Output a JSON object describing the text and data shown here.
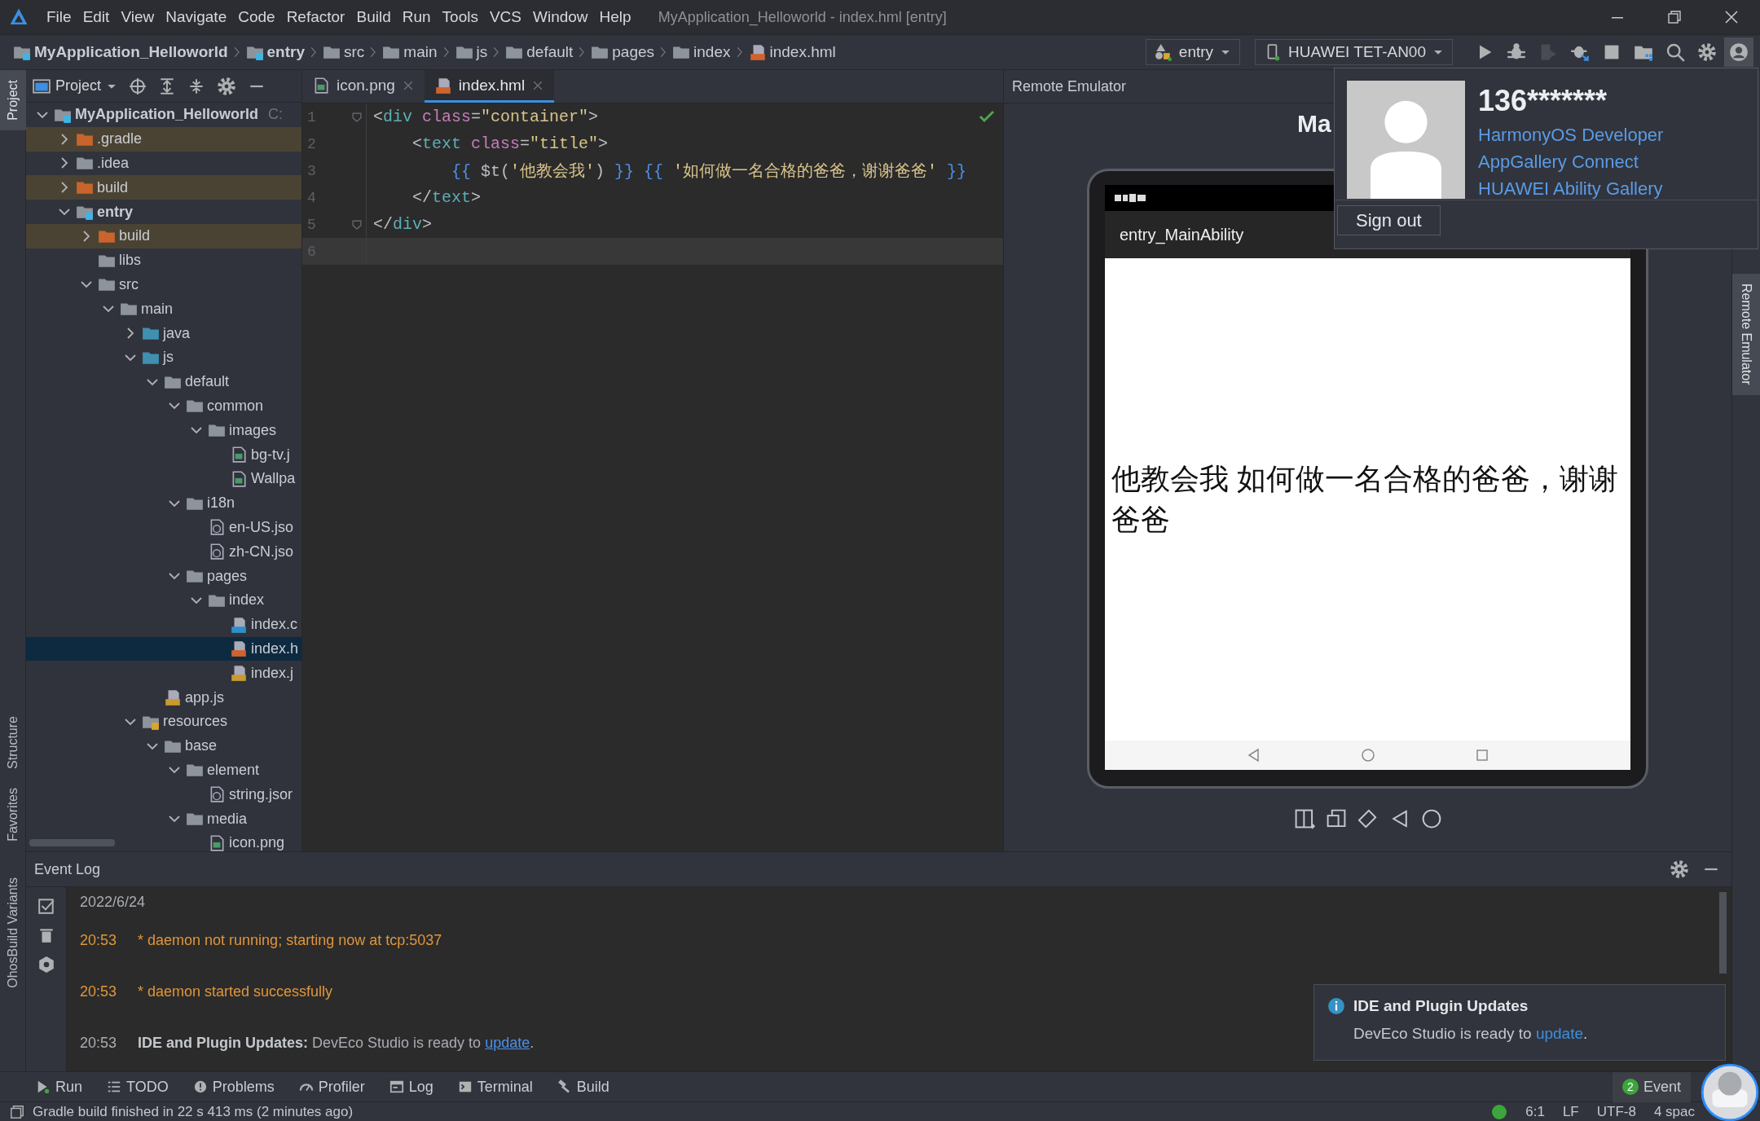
{
  "window": {
    "title": "MyApplication_Helloworld - index.hml [entry]",
    "menu": [
      "File",
      "Edit",
      "View",
      "Navigate",
      "Code",
      "Refactor",
      "Build",
      "Run",
      "Tools",
      "VCS",
      "Window",
      "Help"
    ]
  },
  "breadcrumb": [
    {
      "label": "MyApplication_Helloworld",
      "kind": "module"
    },
    {
      "label": "entry",
      "kind": "module"
    },
    {
      "label": "src",
      "kind": "folder"
    },
    {
      "label": "main",
      "kind": "folder"
    },
    {
      "label": "js",
      "kind": "folder"
    },
    {
      "label": "default",
      "kind": "folder"
    },
    {
      "label": "pages",
      "kind": "folder"
    },
    {
      "label": "index",
      "kind": "folder"
    },
    {
      "label": "index.hml",
      "kind": "html-file"
    }
  ],
  "toolbar": {
    "run_config": "entry",
    "device": "HUAWEI TET-AN00",
    "buttons": [
      {
        "kind": "run",
        "disabled": false,
        "active": false
      },
      {
        "kind": "debug",
        "disabled": false,
        "active": false
      },
      {
        "kind": "attach",
        "disabled": true,
        "active": false
      },
      {
        "kind": "debug-attach",
        "disabled": false,
        "active": false
      },
      {
        "kind": "stop",
        "disabled": false,
        "active": false
      },
      {
        "kind": "project-structure",
        "disabled": false,
        "active": false
      },
      {
        "kind": "search",
        "disabled": false,
        "active": false
      },
      {
        "kind": "settings",
        "disabled": false,
        "active": false
      },
      {
        "kind": "account",
        "disabled": false,
        "active": true
      }
    ]
  },
  "left_strip": [
    {
      "label": "Project",
      "selected": true
    },
    {
      "label": "Structure",
      "selected": false
    },
    {
      "label": "Favorites",
      "selected": false
    },
    {
      "label": "OhosBuild Variants",
      "selected": false
    }
  ],
  "project": {
    "title": "Project",
    "tree": [
      {
        "label": "MyApplication_Helloworld",
        "kind": "module",
        "path": "C:",
        "expanded": true,
        "selected": false,
        "children": [
          {
            "label": ".gradle",
            "kind": "folder-excluded",
            "expanded": false,
            "excluded": true,
            "selected": false
          },
          {
            "label": ".idea",
            "kind": "folder",
            "expanded": false,
            "selected": false
          },
          {
            "label": "build",
            "kind": "folder-excluded",
            "expanded": false,
            "excluded": true,
            "selected": false
          },
          {
            "label": "entry",
            "kind": "module",
            "expanded": true,
            "selected": false,
            "children": [
              {
                "label": "build",
                "kind": "folder-excluded",
                "expanded": false,
                "excluded": true,
                "selected": false
              },
              {
                "label": "libs",
                "kind": "folder",
                "selected": false
              },
              {
                "label": "src",
                "kind": "folder",
                "expanded": true,
                "selected": false,
                "children": [
                  {
                    "label": "main",
                    "kind": "folder",
                    "expanded": true,
                    "selected": false,
                    "children": [
                      {
                        "label": "java",
                        "kind": "folder-source",
                        "expanded": false,
                        "selected": false
                      },
                      {
                        "label": "js",
                        "kind": "folder-source",
                        "expanded": true,
                        "selected": false,
                        "children": [
                          {
                            "label": "default",
                            "kind": "folder",
                            "expanded": true,
                            "selected": false,
                            "children": [
                              {
                                "label": "common",
                                "kind": "folder",
                                "expanded": true,
                                "selected": false,
                                "children": [
                                  {
                                    "label": "images",
                                    "kind": "folder",
                                    "expanded": true,
                                    "selected": false,
                                    "children": [
                                      {
                                        "label": "bg-tv.j",
                                        "kind": "image-file",
                                        "selected": false
                                      },
                                      {
                                        "label": "Wallpa",
                                        "kind": "image-file",
                                        "selected": false
                                      }
                                    ]
                                  }
                                ]
                              },
                              {
                                "label": "i18n",
                                "kind": "folder",
                                "expanded": true,
                                "selected": false,
                                "children": [
                                  {
                                    "label": "en-US.jso",
                                    "kind": "json-file",
                                    "selected": false
                                  },
                                  {
                                    "label": "zh-CN.jso",
                                    "kind": "json-file",
                                    "selected": false
                                  }
                                ]
                              },
                              {
                                "label": "pages",
                                "kind": "folder",
                                "expanded": true,
                                "selected": false,
                                "children": [
                                  {
                                    "label": "index",
                                    "kind": "folder",
                                    "expanded": true,
                                    "selected": false,
                                    "children": [
                                      {
                                        "label": "index.c",
                                        "kind": "css-file",
                                        "selected": false
                                      },
                                      {
                                        "label": "index.h",
                                        "kind": "html-file",
                                        "selected": true
                                      },
                                      {
                                        "label": "index.j",
                                        "kind": "js-file",
                                        "selected": false
                                      }
                                    ]
                                  }
                                ]
                              }
                            ]
                          },
                          {
                            "label": "app.js",
                            "kind": "js-file",
                            "selected": false
                          }
                        ]
                      },
                      {
                        "label": "resources",
                        "kind": "resources",
                        "expanded": true,
                        "selected": false,
                        "children": [
                          {
                            "label": "base",
                            "kind": "folder",
                            "expanded": true,
                            "selected": false,
                            "children": [
                              {
                                "label": "element",
                                "kind": "folder",
                                "expanded": true,
                                "selected": false,
                                "children": [
                                  {
                                    "label": "string.jsor",
                                    "kind": "json-file",
                                    "selected": false
                                  }
                                ]
                              },
                              {
                                "label": "media",
                                "kind": "folder",
                                "expanded": true,
                                "selected": false,
                                "children": [
                                  {
                                    "label": "icon.png",
                                    "kind": "image-file",
                                    "selected": false
                                  }
                                ]
                              }
                            ]
                          }
                        ]
                      }
                    ]
                  }
                ]
              }
            ]
          }
        ]
      }
    ]
  },
  "editor": {
    "tabs": [
      {
        "label": "icon.png",
        "kind": "image-file",
        "selected": false
      },
      {
        "label": "index.hml",
        "kind": "html-file",
        "selected": true
      }
    ],
    "lines": [
      {
        "number": "1",
        "fold": true,
        "tokens": [
          {
            "kind": "punct",
            "text": "<"
          },
          {
            "kind": "tag",
            "text": "div"
          },
          {
            "kind": "attr",
            "text": " class"
          },
          {
            "kind": "punct",
            "text": "="
          },
          {
            "kind": "string",
            "text": "\"container\""
          },
          {
            "kind": "punct",
            "text": ">"
          }
        ]
      },
      {
        "number": "2",
        "fold": false,
        "tokens": [
          {
            "kind": "punct",
            "text": "    <"
          },
          {
            "kind": "tag",
            "text": "text"
          },
          {
            "kind": "attr",
            "text": " class"
          },
          {
            "kind": "punct",
            "text": "="
          },
          {
            "kind": "string",
            "text": "\"title\""
          },
          {
            "kind": "punct",
            "text": ">"
          }
        ]
      },
      {
        "number": "3",
        "fold": false,
        "tokens": [
          {
            "kind": "brace",
            "text": "        {{"
          },
          {
            "kind": "plain",
            "text": " $t("
          },
          {
            "kind": "string",
            "text": "'他教会我'"
          },
          {
            "kind": "plain",
            "text": ") "
          },
          {
            "kind": "brace",
            "text": "}} {{"
          },
          {
            "kind": "string",
            "text": " '如何做一名合格的爸爸，谢谢爸爸'"
          },
          {
            "kind": "brace",
            "text": " }}"
          }
        ]
      },
      {
        "number": "4",
        "fold": false,
        "tokens": [
          {
            "kind": "punct",
            "text": "    </"
          },
          {
            "kind": "tag",
            "text": "text"
          },
          {
            "kind": "punct",
            "text": ">"
          }
        ]
      },
      {
        "number": "5",
        "fold": true,
        "tokens": [
          {
            "kind": "punct",
            "text": "</"
          },
          {
            "kind": "tag",
            "text": "div"
          },
          {
            "kind": "punct",
            "text": ">"
          }
        ]
      },
      {
        "number": "6",
        "fold": false,
        "current": true
      }
    ]
  },
  "emulator": {
    "title": "Remote Emulator",
    "heading": "Ma",
    "app_title": "entry_MainAbility",
    "screen_text": "他教会我 如何做一名合格的爸爸，谢谢爸爸"
  },
  "right_strip": [
    {
      "label": "Remote Emulator",
      "selected": true
    }
  ],
  "account_popup": {
    "user": "136*******",
    "links": [
      "HarmonyOS Developer",
      "AppGallery Connect",
      "HUAWEI Ability Gallery"
    ],
    "button": "Sign out"
  },
  "event_log": {
    "title": "Event Log",
    "date": "2022/6/24",
    "entries": [
      {
        "time": "20:53",
        "kind": "warning",
        "text": "* daemon not running; starting now at tcp:5037"
      },
      {
        "time": "20:53",
        "kind": "warning",
        "text": "* daemon started successfully"
      },
      {
        "time": "20:53",
        "kind": "info",
        "text": "**IDE and Plugin Updates:** DevEco Studio is ready to ",
        "link": "update",
        "suffix": "."
      }
    ]
  },
  "notification": {
    "title": "IDE and Plugin Updates",
    "text": "DevEco Studio is ready to ",
    "link": "update",
    "suffix": "."
  },
  "tool_windows": [
    {
      "label": "Run",
      "kind": "run"
    },
    {
      "label": "TODO",
      "kind": "todo"
    },
    {
      "label": "Problems",
      "kind": "problems"
    },
    {
      "label": "Profiler",
      "kind": "profiler"
    },
    {
      "label": "Log",
      "kind": "log"
    },
    {
      "label": "Terminal",
      "kind": "terminal"
    },
    {
      "label": "Build",
      "kind": "build"
    }
  ],
  "event_tab": {
    "label": "Event",
    "badge": "2"
  },
  "status_bar": {
    "message": "Gradle build finished in 22 s 413 ms (2 minutes ago)",
    "position": "6:1",
    "line_ending": "LF",
    "encoding": "UTF-8",
    "indent": "4 spac"
  }
}
